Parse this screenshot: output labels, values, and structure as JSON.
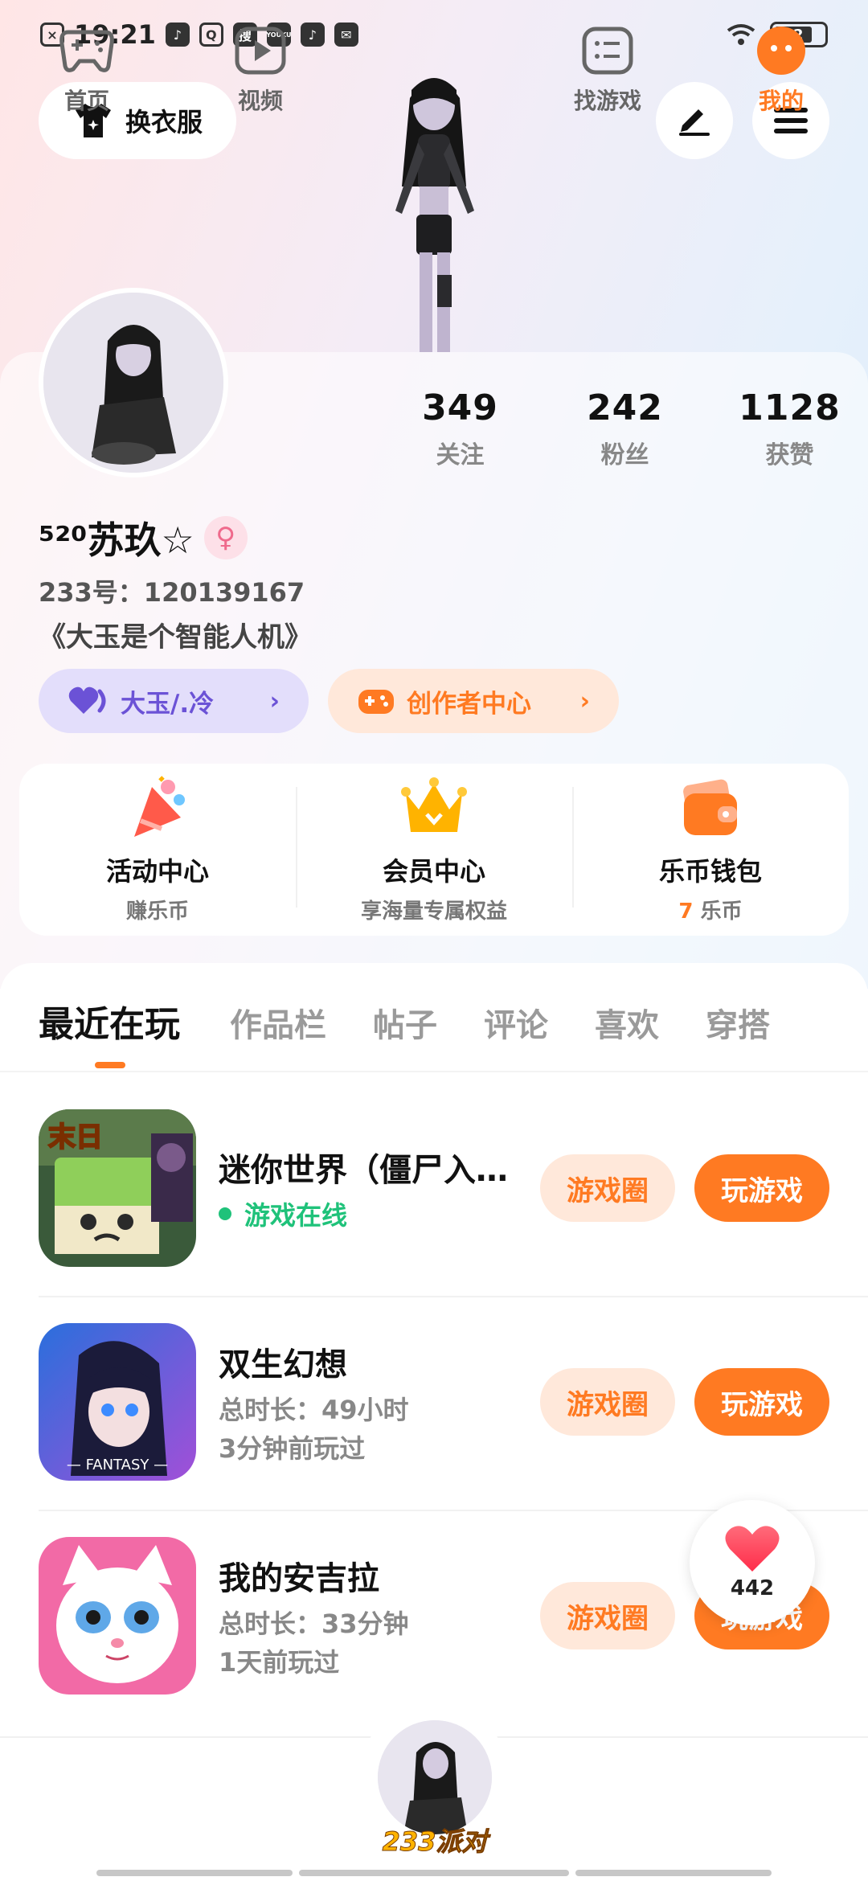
{
  "status_bar": {
    "time": "19:21",
    "app_icons": [
      "tiktok-icon",
      "search-app-icon",
      "sou-icon",
      "youku-icon",
      "tiktok-icon",
      "message-icon"
    ],
    "sou_label": "搜",
    "youku_label": "YOUKU",
    "battery": "22"
  },
  "header": {
    "dress_label": "换衣服",
    "edit_icon": "pen-icon",
    "menu_icon": "menu-icon"
  },
  "profile": {
    "nickname": "⁵²⁰苏玖☆",
    "gender_symbol": "♀",
    "uid": "233号：120139167",
    "signature": "《大玉是个智能人机》",
    "stats": [
      {
        "num": "349",
        "label": "关注"
      },
      {
        "num": "242",
        "label": "粉丝"
      },
      {
        "num": "1128",
        "label": "获赞"
      }
    ],
    "relation_pill": "大玉/.冷",
    "creator_pill": "创作者中心"
  },
  "quick_actions": [
    {
      "title": "活动中心",
      "sub": "赚乐币"
    },
    {
      "title": "会员中心",
      "sub": "享海量专属权益"
    },
    {
      "title": "乐币钱包",
      "sub_num": "7",
      "sub": " 乐币"
    }
  ],
  "tabs": [
    "最近在玩",
    "作品栏",
    "帖子",
    "评论",
    "喜欢",
    "穿搭"
  ],
  "games": [
    {
      "name": "迷你世界（僵尸入侵）",
      "status": "游戏在线",
      "circle_btn": "游戏圈",
      "play_btn": "玩游戏"
    },
    {
      "name": "双生幻想",
      "duration": "总时长：49小时",
      "last": "3分钟前玩过",
      "circle_btn": "游戏圈",
      "play_btn": "玩游戏",
      "icon_text": "— FANTASY —"
    },
    {
      "name": "我的安吉拉",
      "duration": "总时长：33分钟",
      "last": "1天前玩过",
      "circle_btn": "游戏圈",
      "play_btn": "玩游戏"
    }
  ],
  "game1_badge": "末日",
  "float_like": {
    "count": "442"
  },
  "bottom_nav": {
    "home": "首页",
    "video": "视频",
    "party": "233派对",
    "find": "找游戏",
    "mine": "我的"
  },
  "colors": {
    "accent": "#ff7a22",
    "online": "#1fc27a",
    "purple": "#6b52d6"
  }
}
